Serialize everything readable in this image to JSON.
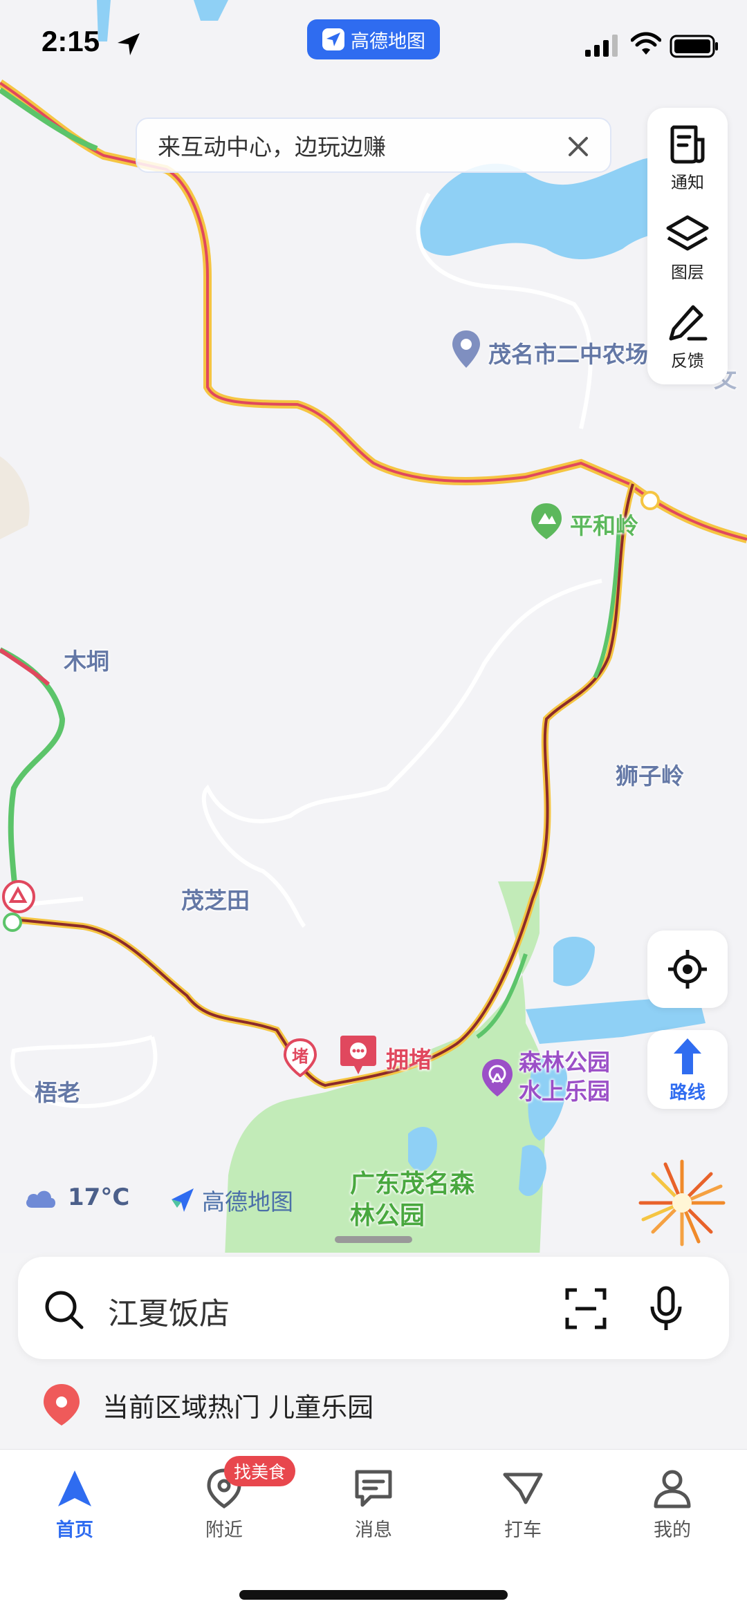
{
  "status_bar": {
    "time": "2:15",
    "app_badge_label": "高德地图"
  },
  "banner": {
    "text": "来互动中心，边玩边赚"
  },
  "tools": {
    "notice_label": "通知",
    "layers_label": "图层",
    "feedback_label": "反馈"
  },
  "map": {
    "labels": {
      "school": "茂名市二中农场",
      "pinghe": "平和岭",
      "mutong": "木垌",
      "shiziling": "狮子岭",
      "maozhitian": "茂芝田",
      "wulao": "梧老",
      "congestion": "拥堵",
      "du_marker": "堵",
      "water_park": "森林公园水上乐园",
      "forest_park": "广东茂名森林公园",
      "edge_text": "文"
    },
    "colors": {
      "road_red": "#e0485e",
      "road_yellow": "#f5c542",
      "road_green": "#5cc46a",
      "road_darkred": "#8b2a2a",
      "park_green": "#c2ebb8",
      "water_blue": "#8fd0f5"
    }
  },
  "route_button_label": "路线",
  "weather": {
    "temp": "17°C",
    "brand": "高德地图"
  },
  "search": {
    "placeholder_text": "江夏饭店"
  },
  "hot": {
    "text": "当前区域热门 儿童乐园"
  },
  "tabs": [
    {
      "label": "首页",
      "icon": "navigation-arrow-icon"
    },
    {
      "label": "附近",
      "icon": "location-pin-icon"
    },
    {
      "label": "消息",
      "icon": "message-icon"
    },
    {
      "label": "打车",
      "icon": "taxi-icon"
    },
    {
      "label": "我的",
      "icon": "person-icon"
    }
  ],
  "food_badge": "找美食"
}
